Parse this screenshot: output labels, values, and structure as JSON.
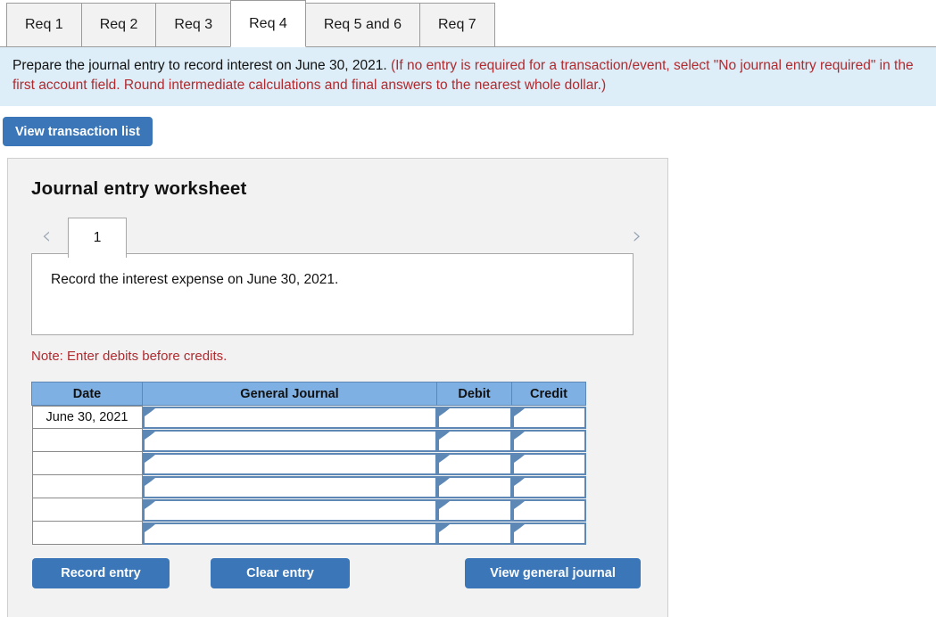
{
  "tabs": [
    {
      "label": "Req 1",
      "active": false
    },
    {
      "label": "Req 2",
      "active": false
    },
    {
      "label": "Req 3",
      "active": false
    },
    {
      "label": "Req 4",
      "active": true
    },
    {
      "label": "Req 5 and 6",
      "active": false
    },
    {
      "label": "Req 7",
      "active": false
    }
  ],
  "banner": {
    "main_text": "Prepare the journal entry to record interest on June 30, 2021. ",
    "note_text": "(If no entry is required for a transaction/event, select \"No journal entry required\" in the first account field. Round intermediate calculations and final answers to the nearest whole dollar.)"
  },
  "toolbar": {
    "view_transaction_list_label": "View transaction list"
  },
  "worksheet": {
    "title": "Journal entry worksheet",
    "pager": {
      "prev_icon": "chevron-left-icon",
      "next_icon": "chevron-right-icon",
      "current_page": "1"
    },
    "description": "Record the interest expense on June 30, 2021.",
    "note": "Note: Enter debits before credits.",
    "table": {
      "headers": [
        "Date",
        "General Journal",
        "Debit",
        "Credit"
      ],
      "rows": [
        {
          "date": "June 30, 2021",
          "general_journal": "",
          "debit": "",
          "credit": ""
        },
        {
          "date": "",
          "general_journal": "",
          "debit": "",
          "credit": ""
        },
        {
          "date": "",
          "general_journal": "",
          "debit": "",
          "credit": ""
        },
        {
          "date": "",
          "general_journal": "",
          "debit": "",
          "credit": ""
        },
        {
          "date": "",
          "general_journal": "",
          "debit": "",
          "credit": ""
        },
        {
          "date": "",
          "general_journal": "",
          "debit": "",
          "credit": ""
        }
      ]
    },
    "buttons": {
      "record_entry_label": "Record entry",
      "clear_entry_label": "Clear entry",
      "view_general_journal_label": "View general journal"
    }
  },
  "colors": {
    "accent_blue": "#3a76b8",
    "banner_bg": "#ddeef8",
    "table_header_bg": "#7fb0e3",
    "input_border": "#5d87b5",
    "alert_red": "#b02a2f",
    "panel_bg": "#f2f2f2"
  }
}
